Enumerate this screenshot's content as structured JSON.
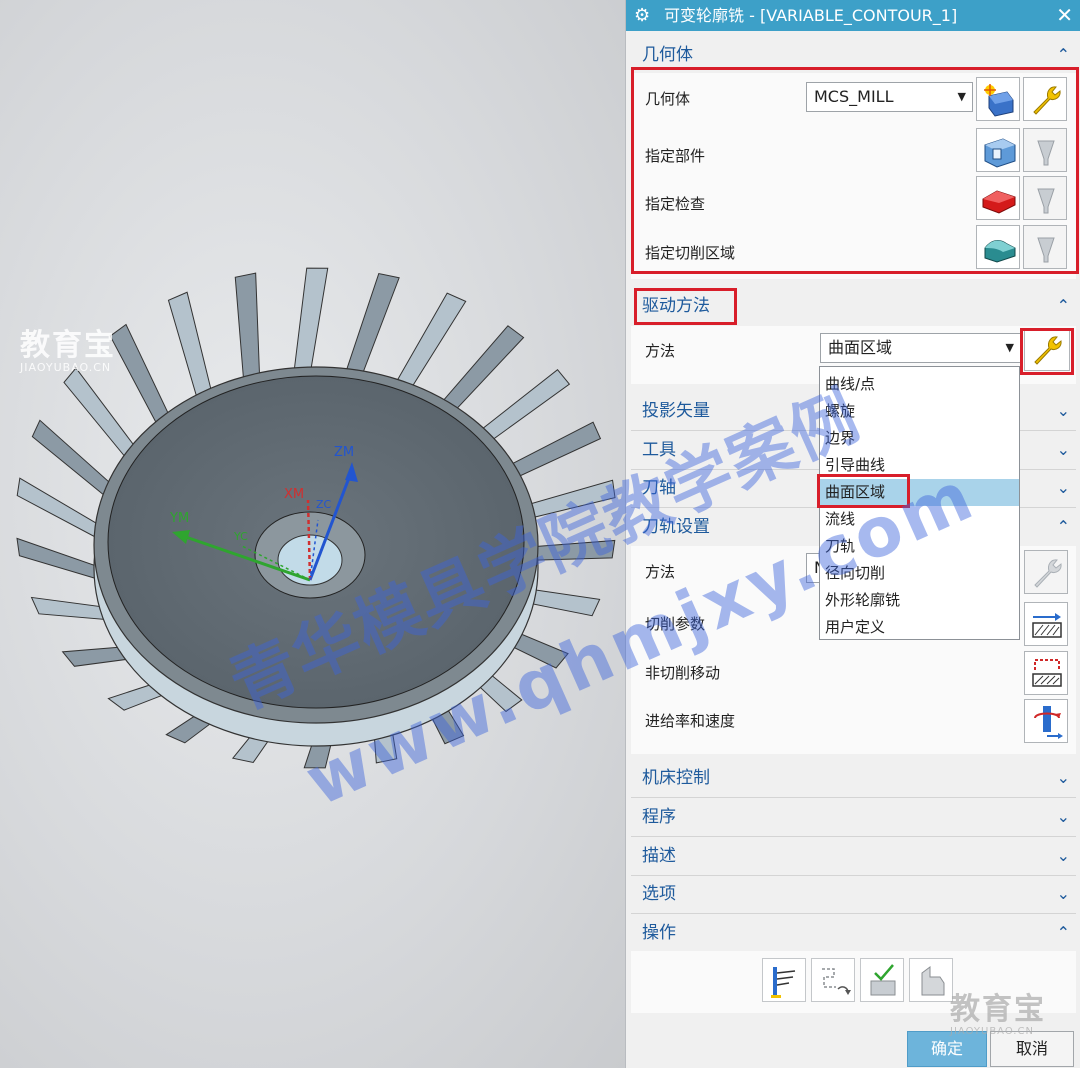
{
  "dialog": {
    "title": "可变轮廓铣 - [VARIABLE_CONTOUR_1]",
    "close_symbol": "✕"
  },
  "geometry": {
    "header": "几何体",
    "geometry_label": "几何体",
    "geometry_value": "MCS_MILL",
    "specify_part": "指定部件",
    "specify_check": "指定检查",
    "specify_cut_area": "指定切削区域"
  },
  "drive": {
    "header": "驱动方法",
    "method_label": "方法",
    "method_value": "曲面区域",
    "options": [
      "曲线/点",
      "螺旋",
      "边界",
      "引导曲线",
      "曲面区域",
      "流线",
      "刀轨",
      "径向切削",
      "外形轮廓铣",
      "用户定义"
    ],
    "selected_index": 4
  },
  "sections": {
    "projection_vector": "投影矢量",
    "tool": "工具",
    "tool_axis": "刀轴",
    "path_settings": "刀轨设置",
    "machine_control": "机床控制",
    "program": "程序",
    "description": "描述",
    "options": "选项",
    "operations": "操作"
  },
  "path_settings": {
    "method_label": "方法",
    "method_value_partial": "N",
    "cut_params": "切削参数",
    "non_cut_moves": "非切削移动",
    "feeds_speeds": "进给率和速度"
  },
  "buttons": {
    "ok": "确定",
    "cancel": "取消"
  },
  "viewport": {
    "axis_zm": "ZM",
    "axis_ym": "YM",
    "axis_xm": "XM",
    "axis_zc": "ZC",
    "axis_yc": "YC"
  },
  "watermarks": {
    "logo": "教育宝",
    "logo_url": "JIAOYUBAO.CN",
    "diagonal_line1": "青华模具学院教学案例",
    "diagonal_line2": "www.qhmjxy.com"
  },
  "icons": {
    "gear": "gear-icon",
    "wrench": "wrench-icon",
    "part": "part-body-icon",
    "check": "check-body-icon",
    "cut_area": "cut-area-icon",
    "display": "display-icon"
  },
  "colors": {
    "title_bar": "#3da0c8",
    "section_header_text": "#1e5a9c",
    "highlight_box": "#d81e2a",
    "selected_option": "#a9d3ea",
    "axis_z": "#2255d0",
    "axis_y": "#2fa52f",
    "axis_x": "#d03030"
  }
}
